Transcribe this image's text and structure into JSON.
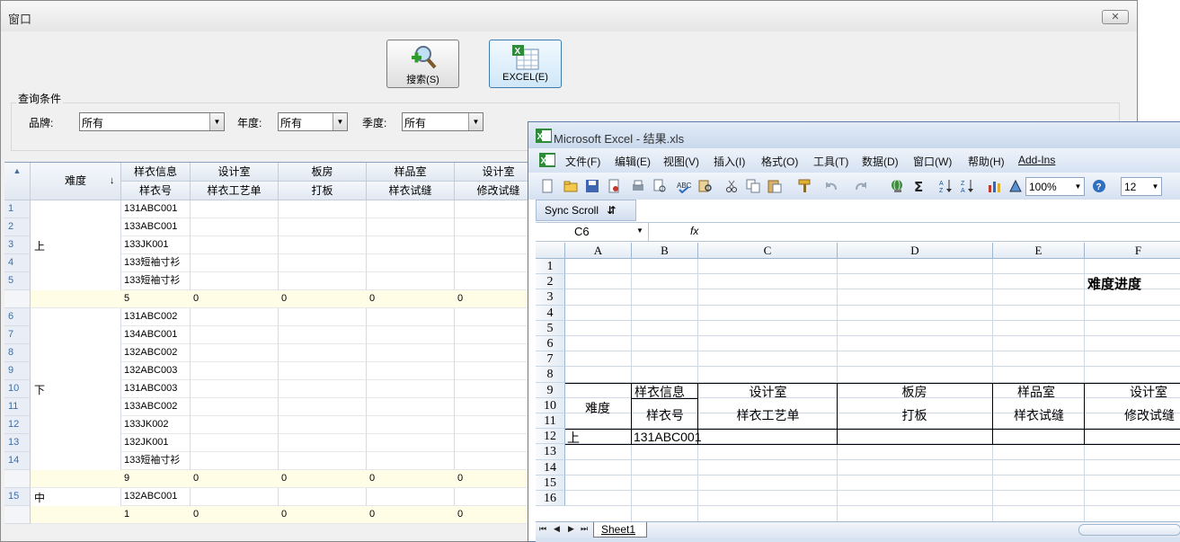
{
  "window": {
    "title": "窗口",
    "close_glyph": "✕"
  },
  "toolbar": {
    "search_label": "搜索(S)",
    "excel_label": "EXCEL(E)"
  },
  "query": {
    "group_title": "查询条件",
    "brand_label": "品牌:",
    "brand_value": "所有",
    "year_label": "年度:",
    "year_value": "所有",
    "season_label": "季度:",
    "season_value": "所有"
  },
  "grid": {
    "corner_glyph": "▲",
    "sort_arrow": "↓",
    "headers_top": [
      "难度",
      "样衣信息",
      "设计室",
      "板房",
      "样品室",
      "设计室"
    ],
    "headers_sub": [
      "样衣号",
      "样衣工艺单",
      "打板",
      "样衣试缝",
      "修改试缝"
    ],
    "groups": [
      {
        "difficulty": "上",
        "rows": [
          {
            "num": "1",
            "code": "131ABC001"
          },
          {
            "num": "2",
            "code": "133ABC001"
          },
          {
            "num": "3",
            "code": "133JK001"
          },
          {
            "num": "4",
            "code": "133短袖寸衫"
          },
          {
            "num": "5",
            "code": "133短袖寸衫"
          }
        ],
        "summary": [
          "5",
          "0",
          "0",
          "0",
          "0"
        ]
      },
      {
        "difficulty": "下",
        "rows": [
          {
            "num": "6",
            "code": "131ABC002"
          },
          {
            "num": "7",
            "code": "134ABC001"
          },
          {
            "num": "8",
            "code": "132ABC002"
          },
          {
            "num": "9",
            "code": "132ABC003"
          },
          {
            "num": "10",
            "code": "131ABC003"
          },
          {
            "num": "11",
            "code": "133ABC002"
          },
          {
            "num": "12",
            "code": "133JK002"
          },
          {
            "num": "13",
            "code": "132JK001"
          },
          {
            "num": "14",
            "code": "133短袖寸衫"
          }
        ],
        "summary": [
          "9",
          "0",
          "0",
          "0",
          "0"
        ]
      },
      {
        "difficulty": "中",
        "rows": [
          {
            "num": "15",
            "code": "132ABC001"
          }
        ],
        "summary": [
          "1",
          "0",
          "0",
          "0",
          "0"
        ]
      }
    ]
  },
  "excel": {
    "title": "Microsoft Excel - 结果.xls",
    "menus": [
      "文件(F)",
      "编辑(E)",
      "视图(V)",
      "插入(I)",
      "格式(O)",
      "工具(T)",
      "数据(D)",
      "窗口(W)",
      "帮助(H)",
      "Add-Ins"
    ],
    "zoom": "100%",
    "font_size": "12",
    "sync_scroll": "Sync Scroll",
    "name_box": "C6",
    "fx": "fx",
    "columns": [
      "A",
      "B",
      "C",
      "D",
      "E",
      "F"
    ],
    "rows": [
      "1",
      "2",
      "3",
      "4",
      "5",
      "6",
      "7",
      "8",
      "9",
      "10",
      "11",
      "12",
      "13",
      "14",
      "15",
      "16"
    ],
    "cells": {
      "title": "难度进度",
      "h_difficulty": "难度",
      "h_sample_info": "样衣信息",
      "h_design": "设计室",
      "h_pattern": "板房",
      "h_sample_room": "样品室",
      "h_design2": "设计室",
      "h_sample_no": "样衣号",
      "h_process": "样衣工艺单",
      "h_patterning": "打板",
      "h_trial": "样衣试缝",
      "h_modify": "修改试缝",
      "r12_a": "上",
      "r12_b": "131ABC001"
    },
    "sheet_tab": "Sheet1",
    "nav": [
      "⏮",
      "◀",
      "▶",
      "⏭"
    ]
  },
  "colors": {
    "accent": "#3d7bad",
    "summary_row": "#fffde5",
    "grid_header": "#e1e8f1",
    "excel_chrome": "#d6e2f2"
  }
}
